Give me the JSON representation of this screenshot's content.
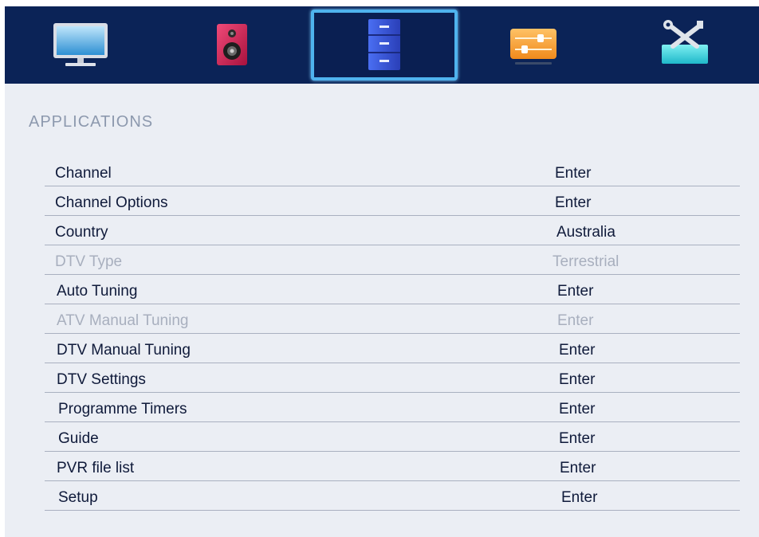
{
  "tabs": [
    {
      "icon": "tv-monitor-icon",
      "selected": false
    },
    {
      "icon": "speaker-icon",
      "selected": false
    },
    {
      "icon": "cabinet-drawers-icon",
      "selected": true
    },
    {
      "icon": "sliders-icon",
      "selected": false
    },
    {
      "icon": "tools-icon",
      "selected": false
    }
  ],
  "menu": {
    "title": "APPLICATIONS",
    "items": [
      {
        "label": "Channel",
        "value": "Enter",
        "enabled": true
      },
      {
        "label": "Channel Options",
        "value": "Enter",
        "enabled": true
      },
      {
        "label": "Country",
        "value": "Australia",
        "enabled": true
      },
      {
        "label": "DTV Type",
        "value": "Terrestrial",
        "enabled": false
      },
      {
        "label": "Auto Tuning",
        "value": "Enter",
        "enabled": true
      },
      {
        "label": "ATV Manual Tuning",
        "value": "Enter",
        "enabled": false
      },
      {
        "label": "DTV Manual Tuning",
        "value": "Enter",
        "enabled": true
      },
      {
        "label": "DTV Settings",
        "value": "Enter",
        "enabled": true
      },
      {
        "label": "Programme Timers",
        "value": "Enter",
        "enabled": true
      },
      {
        "label": "Guide",
        "value": "Enter",
        "enabled": true
      },
      {
        "label": "PVR file list",
        "value": "Enter",
        "enabled": true
      },
      {
        "label": "Setup",
        "value": "Enter",
        "enabled": true
      }
    ]
  },
  "colors": {
    "topbar": "#0b2357",
    "selection_border": "#4fb3ee",
    "panel": "#ebeef4",
    "text": "#0f1a3a",
    "disabled_text": "#a8afbe",
    "title_text": "#8d99ae"
  }
}
